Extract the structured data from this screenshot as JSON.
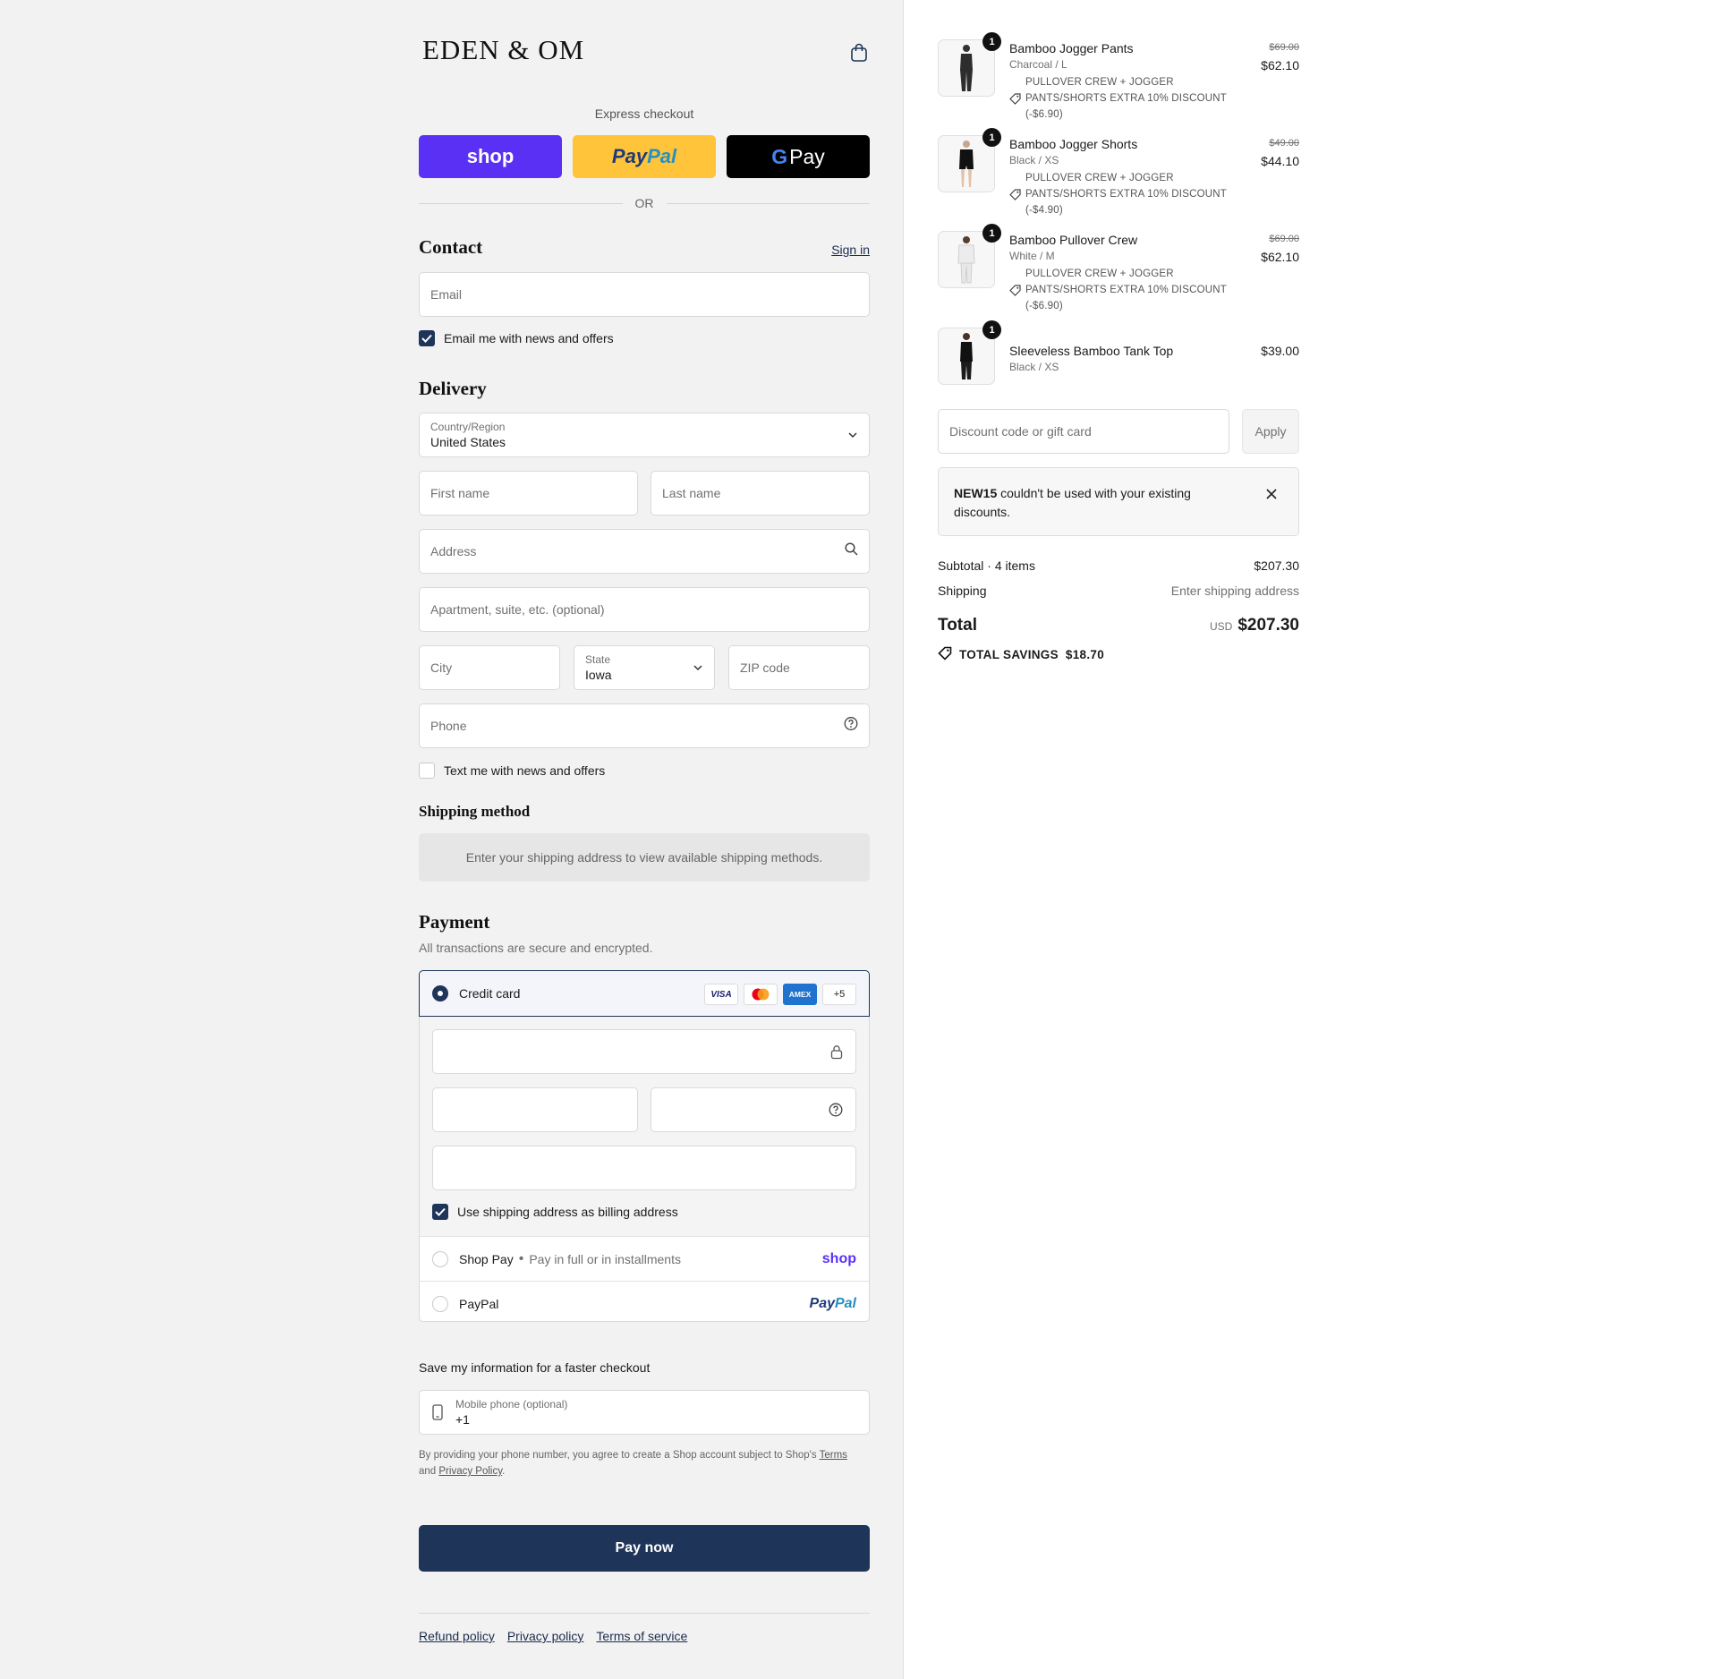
{
  "brand": {
    "logo": "EDEN & OM"
  },
  "express": {
    "title": "Express checkout",
    "shop_label": "shop",
    "paypal_part1": "Pay",
    "paypal_part2": "Pal",
    "gpay_g": "G",
    "gpay_label": "Pay",
    "or": "OR"
  },
  "contact": {
    "heading": "Contact",
    "sign_in": "Sign in",
    "email_placeholder": "Email",
    "email_optin": "Email me with news and offers",
    "email_optin_checked": true
  },
  "delivery": {
    "heading": "Delivery",
    "country_label": "Country/Region",
    "country_value": "United States",
    "first_name_placeholder": "First name",
    "last_name_placeholder": "Last name",
    "address_placeholder": "Address",
    "apartment_placeholder": "Apartment, suite, etc. (optional)",
    "city_placeholder": "City",
    "state_label": "State",
    "state_value": "Iowa",
    "zip_placeholder": "ZIP code",
    "phone_placeholder": "Phone",
    "sms_optin": "Text me with news and offers",
    "sms_optin_checked": false
  },
  "shipping_method": {
    "heading": "Shipping method",
    "info": "Enter your shipping address to view available shipping methods."
  },
  "payment": {
    "heading": "Payment",
    "subtitle": "All transactions are secure and encrypted.",
    "credit_card_label": "Credit card",
    "card_logos": [
      "VISA",
      "mastercard",
      "AMEX",
      "+5"
    ],
    "billing_same": "Use shipping address as billing address",
    "billing_same_checked": true,
    "shop_pay_label": "Shop Pay",
    "shop_pay_sub": "Pay in full or in installments",
    "shop_pay_brand": "shop",
    "paypal_label": "PayPal",
    "paypal_brand_1": "Pay",
    "paypal_brand_2": "Pal"
  },
  "save_info": {
    "title": "Save my information for a faster checkout",
    "mobile_label": "Mobile phone (optional)",
    "mobile_value": "+1",
    "legal_prefix": "By providing your phone number, you agree to create a Shop account subject to Shop's",
    "legal_terms": "Terms",
    "legal_and": "and",
    "legal_privacy": "Privacy Policy",
    "legal_suffix": "."
  },
  "pay_now": "Pay now",
  "footer": [
    "Refund policy",
    "Privacy policy",
    "Terms of service"
  ],
  "cart": {
    "items": [
      {
        "name": "Bamboo Jogger Pants",
        "variant": "Charcoal / L",
        "qty": "1",
        "discount_title": "PULLOVER CREW + JOGGER",
        "discount_detail": "PANTS/SHORTS EXTRA 10% DISCOUNT",
        "discount_amount": "(-$6.90)",
        "original_price": "$69.00",
        "price": "$62.10"
      },
      {
        "name": "Bamboo Jogger Shorts",
        "variant": "Black / XS",
        "qty": "1",
        "discount_title": "PULLOVER CREW + JOGGER",
        "discount_detail": "PANTS/SHORTS EXTRA 10% DISCOUNT",
        "discount_amount": "(-$4.90)",
        "original_price": "$49.00",
        "price": "$44.10"
      },
      {
        "name": "Bamboo Pullover Crew",
        "variant": "White / M",
        "qty": "1",
        "discount_title": "PULLOVER CREW + JOGGER",
        "discount_detail": "PANTS/SHORTS EXTRA 10% DISCOUNT",
        "discount_amount": "(-$6.90)",
        "original_price": "$69.00",
        "price": "$62.10"
      },
      {
        "name": "Sleeveless Bamboo Tank Top",
        "variant": "Black / XS",
        "qty": "1",
        "price": "$39.00"
      }
    ],
    "discount_placeholder": "Discount code or gift card",
    "apply": "Apply",
    "notice_code": "NEW15",
    "notice_text": "couldn't be used with your existing discounts.",
    "subtotal_label": "Subtotal · 4 items",
    "subtotal_value": "$207.30",
    "shipping_label": "Shipping",
    "shipping_value": "Enter shipping address",
    "total_label": "Total",
    "total_currency": "USD",
    "total_value": "$207.30",
    "savings_label": "TOTAL SAVINGS",
    "savings_value": "$18.70"
  },
  "colors": {
    "primary": "#1e3458",
    "shop_purple": "#5a31f4",
    "paypal_yellow": "#ffc439"
  }
}
